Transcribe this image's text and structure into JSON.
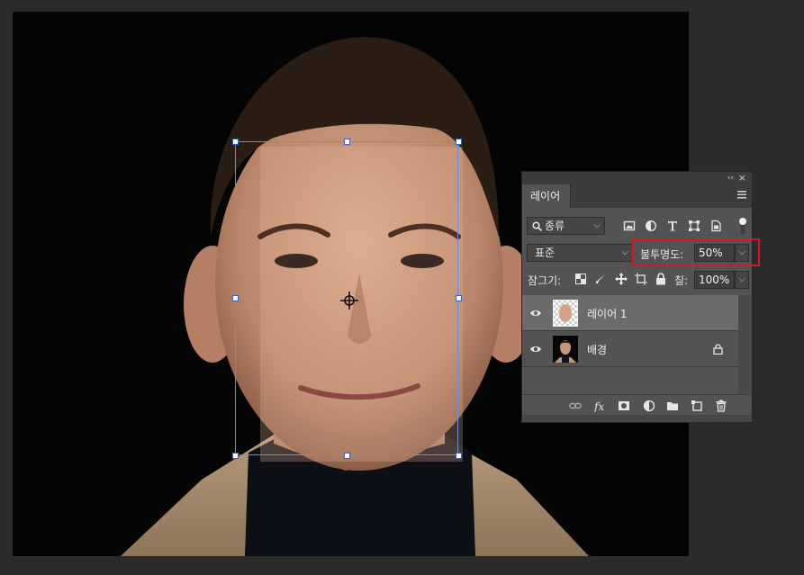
{
  "panel": {
    "title": "레이어",
    "collapse_glyph": "‹‹",
    "close_glyph": "×",
    "filter": {
      "label": "종류",
      "icon": "search-icon"
    },
    "blend_mode": "표준",
    "opacity": {
      "label": "불투명도:",
      "value": "50%"
    },
    "lock": {
      "label": "잠그기:"
    },
    "fill": {
      "label": "칠:",
      "value": "100%"
    },
    "layers": [
      {
        "name": "레이어 1",
        "selected": true,
        "visible": true,
        "locked": false
      },
      {
        "name": "배경",
        "selected": false,
        "visible": true,
        "locked": true
      }
    ],
    "bottom_icons": [
      "link-icon",
      "fx-icon",
      "mask-icon",
      "adjustment-icon",
      "folder-icon",
      "new-layer-icon",
      "trash-icon"
    ]
  },
  "colors": {
    "highlight": "#e0141e",
    "transform_box": "#6e8fd6",
    "panel_bg": "#535353",
    "canvas_bg": "#2b2b2b"
  }
}
